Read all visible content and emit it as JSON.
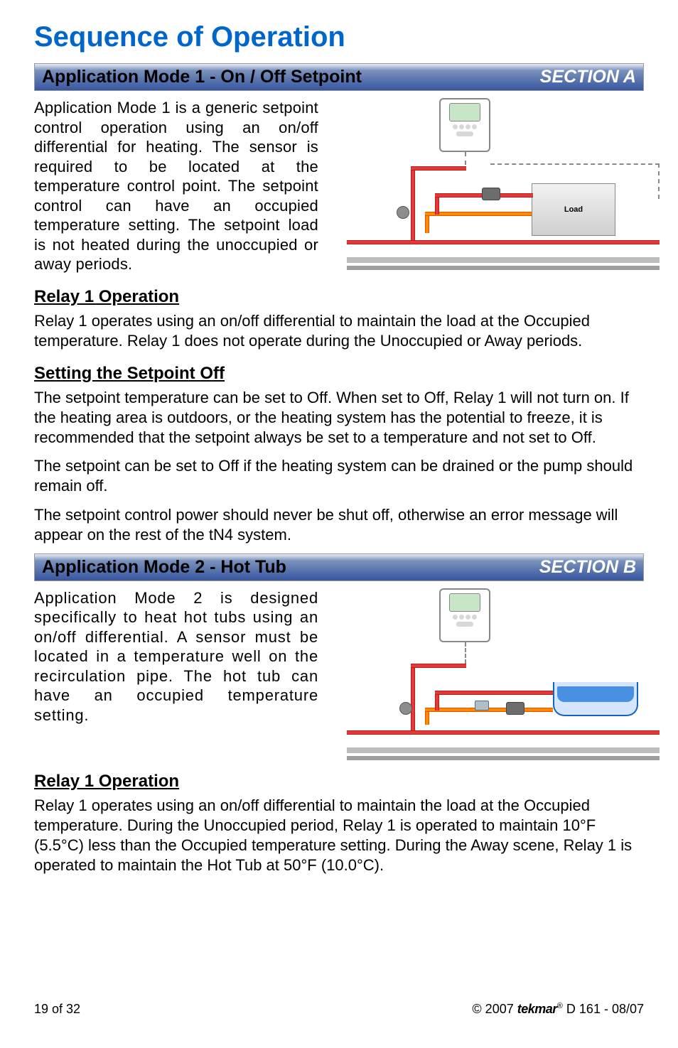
{
  "title": "Sequence of Operation",
  "section_a": {
    "bar_left": "Application Mode 1 - On / Off Setpoint",
    "bar_right": "SECTION A",
    "intro": "Application Mode 1 is a generic setpoint control operation using an on/off differential for heating. The sensor is required to be located at the temperature control point. The setpoint control can have an occupied temperature setting. The setpoint load is not heated during the unoccupied or away periods.",
    "load_label": "Load",
    "relay_head": "Relay 1 Operation",
    "relay_body": "Relay 1 operates using an on/off differential to maintain the load at the Occupied temperature. Relay 1 does not operate during the Unoccupied or Away periods.",
    "setoff_head": "Setting the Setpoint Off",
    "setoff_p1": "The setpoint temperature can be set to Off. When set to Off, Relay 1 will not turn on. If the heating area is outdoors, or the heating system has the potential to freeze, it is recommended that the setpoint always be set to a temperature and not set to Off.",
    "setoff_p2": "The setpoint can be set to Off if the heating system can be drained or the pump should remain off.",
    "setoff_p3": "The setpoint control power should never be shut off, otherwise an error message will appear on the rest of the tN4 system."
  },
  "section_b": {
    "bar_left": "Application Mode 2 - Hot Tub",
    "bar_right": "SECTION B",
    "intro": "Application Mode 2 is designed specifically to heat hot tubs using an on/off differential. A sensor must be located in a temperature well on the recirculation pipe. The hot tub can have an occupied temperature setting.",
    "relay_head": "Relay 1 Operation",
    "relay_body": "Relay 1 operates using an on/off differential to maintain the load at the Occupied temperature. During the Unoccupied period, Relay 1 is operated to maintain 10°F (5.5°C) less than the Occupied temperature setting. During the Away scene, Relay 1 is operated to maintain the Hot Tub at 50°F (10.0°C)."
  },
  "footer": {
    "page": "19 of 32",
    "copyright": "© 2007",
    "brand": "tekmar",
    "doc": " D 161 - 08/07"
  }
}
